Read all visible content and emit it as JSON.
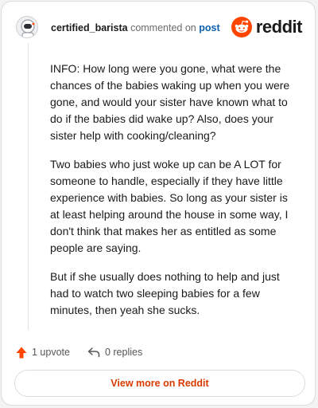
{
  "header": {
    "username": "certified_barista",
    "action_text": "commented on",
    "post_link": "post",
    "brand_name": "reddit",
    "brand_color": "#ff4500"
  },
  "comment": {
    "paragraphs": [
      "INFO: How long were you gone, what were the chances of the babies waking up when you were gone, and would your sister have known what to do if the babies did wake up? Also, does your sister help with cooking/cleaning?",
      "Two babies who just woke up can be A LOT for someone to handle, especially if they have little experience with babies. So long as your sister is at least helping around the house in some way, I don't think that makes her as entitled as some people are saying.",
      "But if she usually does nothing to help and just had to watch two sleeping babies for a few minutes, then yeah she sucks."
    ]
  },
  "actions": {
    "upvote_icon": "upvote-arrow-icon",
    "upvote_label": "1 upvote",
    "upvote_color": "#ff4500",
    "reply_icon": "reply-arrow-icon",
    "replies_label": "0 replies"
  },
  "footer": {
    "view_button_label": "View more on Reddit",
    "view_button_color": "#d93a00"
  }
}
